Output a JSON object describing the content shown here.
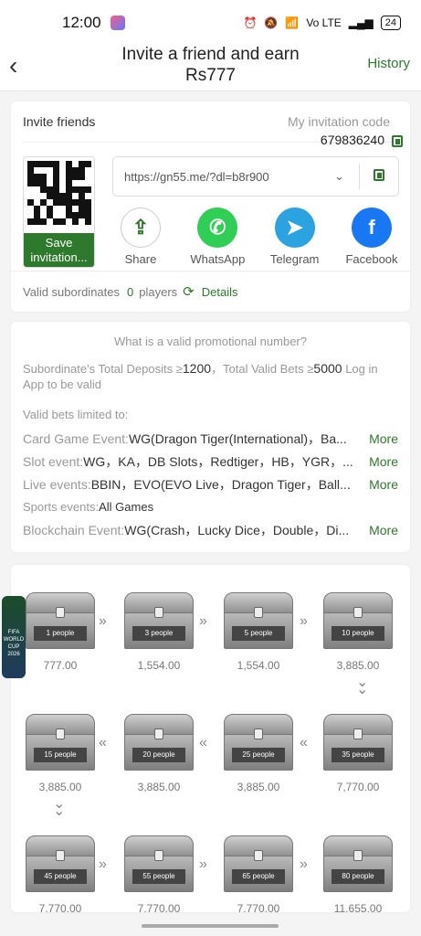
{
  "status": {
    "time": "12:00",
    "battery": "24",
    "net": "Vo LTE"
  },
  "header": {
    "title": "Invite a friend and earn Rs777",
    "history": "History"
  },
  "invite": {
    "label": "Invite friends",
    "code_label": "My invitation code",
    "code": "679836240",
    "save": "Save invitation...",
    "url": "https://gn55.me/?dl=b8r900",
    "shares": [
      {
        "label": "Share",
        "icon": "share-icon"
      },
      {
        "label": "WhatsApp",
        "icon": "whatsapp-icon"
      },
      {
        "label": "Telegram",
        "icon": "telegram-icon"
      },
      {
        "label": "Facebook",
        "icon": "facebook-icon"
      }
    ],
    "valid_label": "Valid subordinates",
    "valid_count": "0",
    "valid_unit": "players",
    "details": "Details"
  },
  "rules": {
    "question": "What is a valid promotional number?",
    "cond1": "Subordinate's Total Deposits ≥",
    "dep": "1200",
    "cond2": "，Total Valid Bets ≥",
    "bets": "5000",
    "cond3": " Log in App to be valid",
    "limited": "Valid bets limited to:",
    "rows": [
      {
        "k": "Card Game Event: ",
        "v": "WG(Dragon Tiger(International)，Ba...",
        "more": "More"
      },
      {
        "k": "Slot event: ",
        "v": "WG，KA，DB Slots，Redtiger，HB，YGR，...",
        "more": "More"
      },
      {
        "k": "Live events: ",
        "v": "BBIN，EVO(EVO Live，Dragon Tiger，Ball...",
        "more": "More"
      },
      {
        "k": "Sports events: ",
        "v": "All Games",
        "more": ""
      },
      {
        "k": "Blockchain Event: ",
        "v": "WG(Crash，Lucky Dice，Double，Di...",
        "more": "More"
      }
    ]
  },
  "chests": [
    {
      "label": "1 people",
      "amount": "777.00"
    },
    {
      "label": "3 people",
      "amount": "1,554.00"
    },
    {
      "label": "5 people",
      "amount": "1,554.00"
    },
    {
      "label": "10 people",
      "amount": "3,885.00"
    },
    {
      "label": "35 people",
      "amount": "7,770.00"
    },
    {
      "label": "25 people",
      "amount": "3,885.00"
    },
    {
      "label": "20 people",
      "amount": "3,885.00"
    },
    {
      "label": "15 people",
      "amount": "3,885.00"
    },
    {
      "label": "45 people",
      "amount": "7,770.00"
    },
    {
      "label": "55 people",
      "amount": "7,770.00"
    },
    {
      "label": "65 people",
      "amount": "7,770.00"
    },
    {
      "label": "80 people",
      "amount": "11,655.00"
    }
  ],
  "fifa": "FIFA WORLD CUP 2026"
}
